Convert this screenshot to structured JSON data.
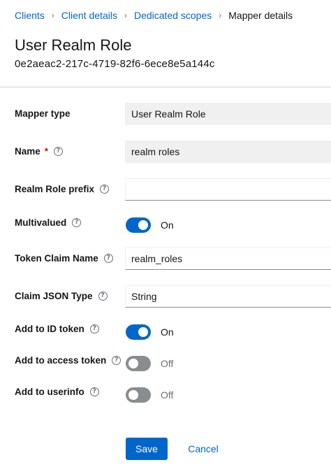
{
  "breadcrumb": {
    "items": [
      "Clients",
      "Client details",
      "Dedicated scopes"
    ],
    "current": "Mapper details",
    "separator": "›"
  },
  "page": {
    "title": "User Realm Role",
    "subtitle": "0e2aeac2-217c-4719-82f6-6ece8e5a144c"
  },
  "form": {
    "mapper_type": {
      "label": "Mapper type",
      "value": "User Realm Role"
    },
    "name": {
      "label": "Name",
      "required_mark": "*",
      "value": "realm roles"
    },
    "realm_role_prefix": {
      "label": "Realm Role prefix",
      "value": ""
    },
    "multivalued": {
      "label": "Multivalued",
      "state": "On"
    },
    "token_claim_name": {
      "label": "Token Claim Name",
      "value": "realm_roles"
    },
    "claim_json_type": {
      "label": "Claim JSON Type",
      "value": "String"
    },
    "add_to_id_token": {
      "label": "Add to ID token",
      "state": "On"
    },
    "add_to_access_token": {
      "label": "Add to access token",
      "state": "Off"
    },
    "add_to_userinfo": {
      "label": "Add to userinfo",
      "state": "Off"
    }
  },
  "help_icon_glyph": "?",
  "actions": {
    "save": "Save",
    "cancel": "Cancel"
  },
  "colors": {
    "accent": "#0066cc",
    "switch_off": "#8a8d90",
    "required": "#c9190b"
  }
}
